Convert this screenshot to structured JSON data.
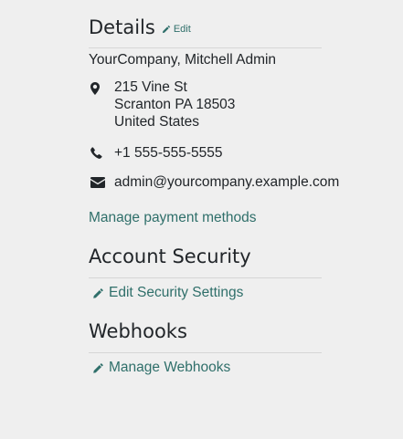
{
  "details": {
    "title": "Details",
    "edit_label": "Edit",
    "name_line": "YourCompany, Mitchell Admin",
    "address": {
      "line1": "215 Vine St",
      "line2": "Scranton PA 18503",
      "line3": "United States"
    },
    "phone": "+1 555-555-5555",
    "email": "admin@yourcompany.example.com",
    "manage_payment_label": "Manage payment methods"
  },
  "account_security": {
    "title": "Account Security",
    "edit_settings_label": "Edit Security Settings"
  },
  "webhooks": {
    "title": "Webhooks",
    "manage_label": "Manage Webhooks"
  },
  "colors": {
    "link": "#2f6f6a",
    "text": "#212529",
    "background": "#efefef",
    "divider": "#d6d6d6"
  },
  "icons": {
    "edit": "pencil-icon",
    "address": "map-marker-icon",
    "phone": "phone-icon",
    "email": "envelope-icon"
  }
}
